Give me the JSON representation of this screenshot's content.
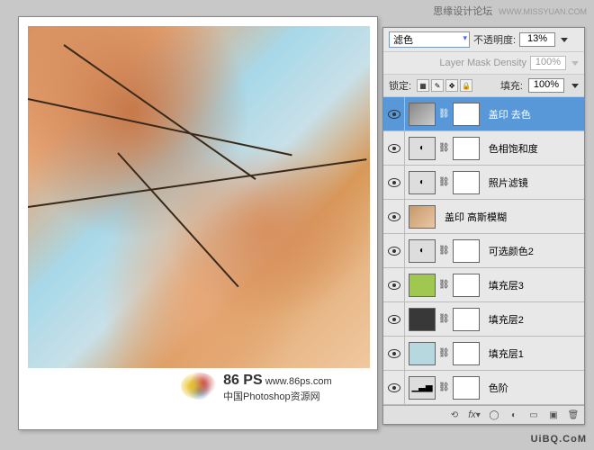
{
  "header": {
    "site_title": "思缘设计论坛",
    "site_url": "WWW.MISSYUAN.COM"
  },
  "logo": {
    "brand": "86 PS",
    "url": "www.86ps.com",
    "tagline": "中国Photoshop资源网"
  },
  "panel": {
    "blend_mode": "滤色",
    "opacity_label": "不透明度:",
    "opacity_value": "13%",
    "mask_density_label": "Layer Mask Density",
    "mask_density_value": "100%",
    "lock_label": "锁定:",
    "fill_label": "填充:",
    "fill_value": "100%"
  },
  "layers": [
    {
      "name": "盖印 去色",
      "selected": true,
      "type": "img-mask"
    },
    {
      "name": "色相饱和度",
      "selected": false,
      "type": "adj"
    },
    {
      "name": "照片滤镜",
      "selected": false,
      "type": "adj"
    },
    {
      "name": "盖印 高斯模糊",
      "selected": false,
      "type": "img"
    },
    {
      "name": "可选颜色2",
      "selected": false,
      "type": "adj"
    },
    {
      "name": "填充层3",
      "selected": false,
      "type": "fill",
      "color": "#a0c850"
    },
    {
      "name": "填充层2",
      "selected": false,
      "type": "fill",
      "color": "#383838"
    },
    {
      "name": "填充层1",
      "selected": false,
      "type": "fill",
      "color": "#b8d8e0"
    },
    {
      "name": "色阶",
      "selected": false,
      "type": "levels"
    }
  ],
  "watermark": {
    "text": "UiBQ.CoM"
  }
}
